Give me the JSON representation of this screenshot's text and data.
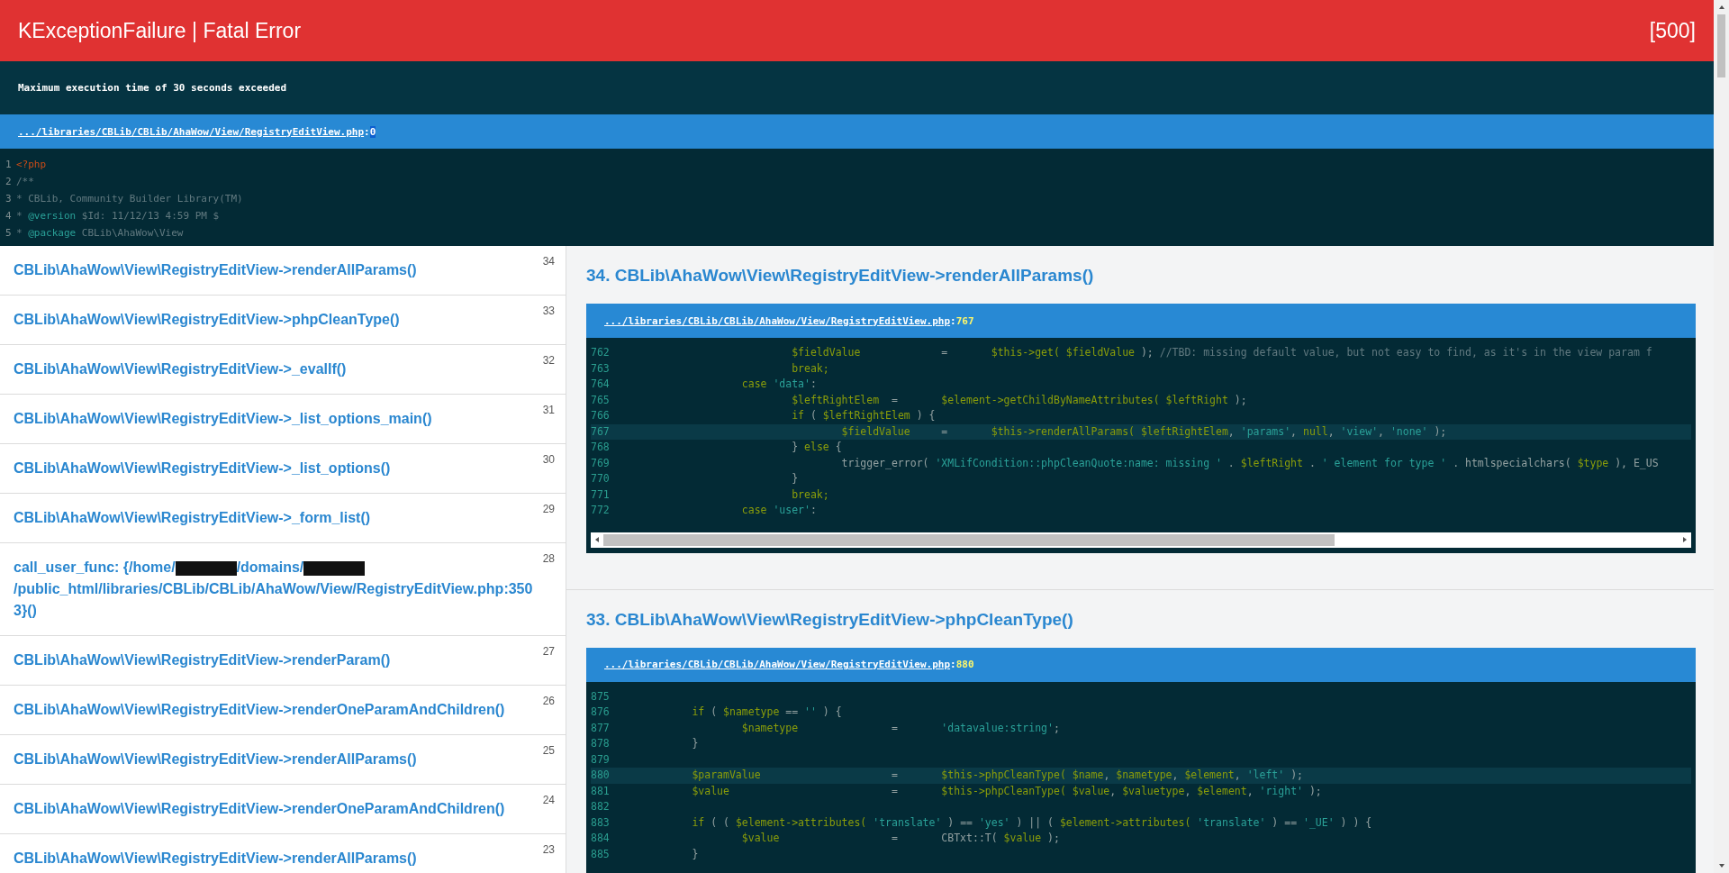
{
  "header": {
    "title": "KExceptionFailure | Fatal Error",
    "code": "[500]"
  },
  "message": "Maximum execution time of 30 seconds exceeded",
  "file_bar": {
    "path": ".../libraries/CBLib/CBLib/AhaWow/View/RegistryEditView.php",
    "separator": ":",
    "line": "0"
  },
  "preview": [
    {
      "number": "1",
      "tokens": [
        {
          "kind": "tag",
          "text": "<?php"
        }
      ]
    },
    {
      "number": "2",
      "tokens": [
        {
          "kind": "comment",
          "text": "/**"
        }
      ]
    },
    {
      "number": "3",
      "tokens": [
        {
          "kind": "comment",
          "text": "* CBLib, Community Builder Library(TM)"
        }
      ]
    },
    {
      "number": "4",
      "tokens": [
        {
          "kind": "comment",
          "text": "* "
        },
        {
          "kind": "doctag",
          "text": "@version"
        },
        {
          "kind": "comment",
          "text": " $Id: 11/12/13 4:59 PM $"
        }
      ]
    },
    {
      "number": "5",
      "tokens": [
        {
          "kind": "comment",
          "text": "* "
        },
        {
          "kind": "doctag",
          "text": "@package"
        },
        {
          "kind": "comment",
          "text": " CBLib\\AhaWow\\View"
        }
      ]
    }
  ],
  "stack": [
    {
      "index": "34",
      "parts": [
        {
          "kind": "text",
          "text": "CBLib\\AhaWow\\View\\RegistryEditView->renderAllParams()"
        }
      ]
    },
    {
      "index": "33",
      "parts": [
        {
          "kind": "text",
          "text": "CBLib\\AhaWow\\View\\RegistryEditView->phpCleanType()"
        }
      ]
    },
    {
      "index": "32",
      "parts": [
        {
          "kind": "text",
          "text": "CBLib\\AhaWow\\View\\RegistryEditView->_evalIf()"
        }
      ]
    },
    {
      "index": "31",
      "parts": [
        {
          "kind": "text",
          "text": "CBLib\\AhaWow\\View\\RegistryEditView->_list_options_main()"
        }
      ]
    },
    {
      "index": "30",
      "parts": [
        {
          "kind": "text",
          "text": "CBLib\\AhaWow\\View\\RegistryEditView->_list_options()"
        }
      ]
    },
    {
      "index": "29",
      "parts": [
        {
          "kind": "text",
          "text": "CBLib\\AhaWow\\View\\RegistryEditView->_form_list()"
        }
      ]
    },
    {
      "index": "28",
      "parts": [
        {
          "kind": "text",
          "text": "call_user_func: {/home/"
        },
        {
          "kind": "redaction"
        },
        {
          "kind": "text",
          "text": "/domains/"
        },
        {
          "kind": "redaction"
        },
        {
          "kind": "text",
          "text": "/public_html/libraries/CBLib/CBLib/AhaWow/View/RegistryEditView.php:3503}()"
        }
      ]
    },
    {
      "index": "27",
      "parts": [
        {
          "kind": "text",
          "text": "CBLib\\AhaWow\\View\\RegistryEditView->renderParam()"
        }
      ]
    },
    {
      "index": "26",
      "parts": [
        {
          "kind": "text",
          "text": "CBLib\\AhaWow\\View\\RegistryEditView->renderOneParamAndChildren()"
        }
      ]
    },
    {
      "index": "25",
      "parts": [
        {
          "kind": "text",
          "text": "CBLib\\AhaWow\\View\\RegistryEditView->renderAllParams()"
        }
      ]
    },
    {
      "index": "24",
      "parts": [
        {
          "kind": "text",
          "text": "CBLib\\AhaWow\\View\\RegistryEditView->renderOneParamAndChildren()"
        }
      ]
    },
    {
      "index": "23",
      "parts": [
        {
          "kind": "text",
          "text": "CBLib\\AhaWow\\View\\RegistryEditView->renderAllParams()"
        }
      ]
    }
  ],
  "frames": [
    {
      "title": "34. CBLib\\AhaWow\\View\\RegistryEditView->renderAllParams()",
      "path": ".../libraries/CBLib/CBLib/AhaWow/View/RegistryEditView.php",
      "separator": ":",
      "line": "767",
      "lines": [
        {
          "number": "762",
          "highlighted": false,
          "tokens": [
            {
              "kind": "var",
              "text": "\t\t\t$fieldValue"
            },
            {
              "kind": "plain",
              "text": "\t\t=\t"
            },
            {
              "kind": "var",
              "text": "$this->get( "
            },
            {
              "kind": "var",
              "text": "$fieldValue"
            },
            {
              "kind": "plain",
              "text": " ); "
            },
            {
              "kind": "comment",
              "text": "//TBD: missing default value, but not easy to find, as it's in the view param f"
            }
          ]
        },
        {
          "number": "763",
          "highlighted": false,
          "tokens": [
            {
              "kind": "var",
              "text": "\t\t\tbreak;"
            }
          ]
        },
        {
          "number": "764",
          "highlighted": false,
          "tokens": [
            {
              "kind": "var",
              "text": "\t\tcase "
            },
            {
              "kind": "str",
              "text": "'data'"
            },
            {
              "kind": "plain",
              "text": ":"
            }
          ]
        },
        {
          "number": "765",
          "highlighted": false,
          "tokens": [
            {
              "kind": "var",
              "text": "\t\t\t$leftRightElem"
            },
            {
              "kind": "plain",
              "text": "  =\t"
            },
            {
              "kind": "var",
              "text": "$element->getChildByNameAttributes( "
            },
            {
              "kind": "var",
              "text": "$leftRight"
            },
            {
              "kind": "plain",
              "text": " );"
            }
          ]
        },
        {
          "number": "766",
          "highlighted": false,
          "tokens": [
            {
              "kind": "var",
              "text": "\t\t\tif"
            },
            {
              "kind": "plain",
              "text": " ( "
            },
            {
              "kind": "var",
              "text": "$leftRightElem"
            },
            {
              "kind": "plain",
              "text": " ) {"
            }
          ]
        },
        {
          "number": "767",
          "highlighted": true,
          "tokens": [
            {
              "kind": "var",
              "text": "\t\t\t\t$fieldValue"
            },
            {
              "kind": "plain",
              "text": "\t=\t"
            },
            {
              "kind": "var",
              "text": "$this->renderAllParams( "
            },
            {
              "kind": "var",
              "text": "$leftRightElem"
            },
            {
              "kind": "plain",
              "text": ", "
            },
            {
              "kind": "str",
              "text": "'params'"
            },
            {
              "kind": "plain",
              "text": ", "
            },
            {
              "kind": "var",
              "text": "null"
            },
            {
              "kind": "plain",
              "text": ", "
            },
            {
              "kind": "str",
              "text": "'view'"
            },
            {
              "kind": "plain",
              "text": ", "
            },
            {
              "kind": "str",
              "text": "'none'"
            },
            {
              "kind": "plain",
              "text": " );"
            }
          ]
        },
        {
          "number": "768",
          "highlighted": false,
          "tokens": [
            {
              "kind": "plain",
              "text": "\t\t\t} "
            },
            {
              "kind": "var",
              "text": "else"
            },
            {
              "kind": "plain",
              "text": " {"
            }
          ]
        },
        {
          "number": "769",
          "highlighted": false,
          "tokens": [
            {
              "kind": "plain",
              "text": "\t\t\t\ttrigger_error( "
            },
            {
              "kind": "str",
              "text": "'XMLifCondition::phpCleanQuote:name: missing '"
            },
            {
              "kind": "plain",
              "text": " . "
            },
            {
              "kind": "var",
              "text": "$leftRight"
            },
            {
              "kind": "plain",
              "text": " . "
            },
            {
              "kind": "str",
              "text": "' element for type '"
            },
            {
              "kind": "plain",
              "text": " . htmlspecialchars( "
            },
            {
              "kind": "var",
              "text": "$type"
            },
            {
              "kind": "plain",
              "text": " ), E_US"
            }
          ]
        },
        {
          "number": "770",
          "highlighted": false,
          "tokens": [
            {
              "kind": "plain",
              "text": "\t\t\t}"
            }
          ]
        },
        {
          "number": "771",
          "highlighted": false,
          "tokens": [
            {
              "kind": "var",
              "text": "\t\t\tbreak;"
            }
          ]
        },
        {
          "number": "772",
          "highlighted": false,
          "tokens": [
            {
              "kind": "var",
              "text": "\t\tcase "
            },
            {
              "kind": "str",
              "text": "'user'"
            },
            {
              "kind": "plain",
              "text": ":"
            }
          ]
        }
      ]
    },
    {
      "title": "33. CBLib\\AhaWow\\View\\RegistryEditView->phpCleanType()",
      "path": ".../libraries/CBLib/CBLib/AhaWow/View/RegistryEditView.php",
      "separator": ":",
      "line": "880",
      "lines": [
        {
          "number": "875",
          "highlighted": false
        },
        {
          "number": "876",
          "highlighted": false,
          "tokens": [
            {
              "kind": "var",
              "text": "\tif"
            },
            {
              "kind": "plain",
              "text": " ( "
            },
            {
              "kind": "var",
              "text": "$nametype"
            },
            {
              "kind": "plain",
              "text": " == "
            },
            {
              "kind": "str",
              "text": "''"
            },
            {
              "kind": "plain",
              "text": " ) {"
            }
          ]
        },
        {
          "number": "877",
          "highlighted": false,
          "tokens": [
            {
              "kind": "var",
              "text": "\t\t$nametype"
            },
            {
              "kind": "plain",
              "text": "\t\t=\t"
            },
            {
              "kind": "str",
              "text": "'datavalue:string'"
            },
            {
              "kind": "plain",
              "text": ";"
            }
          ]
        },
        {
          "number": "878",
          "highlighted": false,
          "tokens": [
            {
              "kind": "plain",
              "text": "\t}"
            }
          ]
        },
        {
          "number": "879",
          "highlighted": false
        },
        {
          "number": "880",
          "highlighted": true,
          "tokens": [
            {
              "kind": "var",
              "text": "\t$paramValue"
            },
            {
              "kind": "plain",
              "text": "\t\t\t=\t"
            },
            {
              "kind": "var",
              "text": "$this->phpCleanType( "
            },
            {
              "kind": "var",
              "text": "$name"
            },
            {
              "kind": "plain",
              "text": ", "
            },
            {
              "kind": "var",
              "text": "$nametype"
            },
            {
              "kind": "plain",
              "text": ", "
            },
            {
              "kind": "var",
              "text": "$element"
            },
            {
              "kind": "plain",
              "text": ", "
            },
            {
              "kind": "str",
              "text": "'left'"
            },
            {
              "kind": "plain",
              "text": " );"
            }
          ]
        },
        {
          "number": "881",
          "highlighted": false,
          "tokens": [
            {
              "kind": "var",
              "text": "\t$value"
            },
            {
              "kind": "plain",
              "text": "\t\t\t\t=\t"
            },
            {
              "kind": "var",
              "text": "$this->phpCleanType( "
            },
            {
              "kind": "var",
              "text": "$value"
            },
            {
              "kind": "plain",
              "text": ", "
            },
            {
              "kind": "var",
              "text": "$valuetype"
            },
            {
              "kind": "plain",
              "text": ", "
            },
            {
              "kind": "var",
              "text": "$element"
            },
            {
              "kind": "plain",
              "text": ", "
            },
            {
              "kind": "str",
              "text": "'right'"
            },
            {
              "kind": "plain",
              "text": " );"
            }
          ]
        },
        {
          "number": "882",
          "highlighted": false
        },
        {
          "number": "883",
          "highlighted": false,
          "tokens": [
            {
              "kind": "var",
              "text": "\tif"
            },
            {
              "kind": "plain",
              "text": " ( ( "
            },
            {
              "kind": "var",
              "text": "$element->attributes( "
            },
            {
              "kind": "str",
              "text": "'translate'"
            },
            {
              "kind": "plain",
              "text": " ) == "
            },
            {
              "kind": "str",
              "text": "'yes'"
            },
            {
              "kind": "plain",
              "text": " ) || ( "
            },
            {
              "kind": "var",
              "text": "$element->attributes( "
            },
            {
              "kind": "str",
              "text": "'translate'"
            },
            {
              "kind": "plain",
              "text": " ) == "
            },
            {
              "kind": "str",
              "text": "'_UE'"
            },
            {
              "kind": "plain",
              "text": " ) ) {"
            }
          ]
        },
        {
          "number": "884",
          "highlighted": false,
          "tokens": [
            {
              "kind": "var",
              "text": "\t\t$value"
            },
            {
              "kind": "plain",
              "text": "\t\t\t=\tCBTxt::T( "
            },
            {
              "kind": "var",
              "text": "$value"
            },
            {
              "kind": "plain",
              "text": " );"
            }
          ]
        },
        {
          "number": "885",
          "highlighted": false,
          "tokens": [
            {
              "kind": "plain",
              "text": "\t}"
            }
          ]
        }
      ]
    }
  ]
}
